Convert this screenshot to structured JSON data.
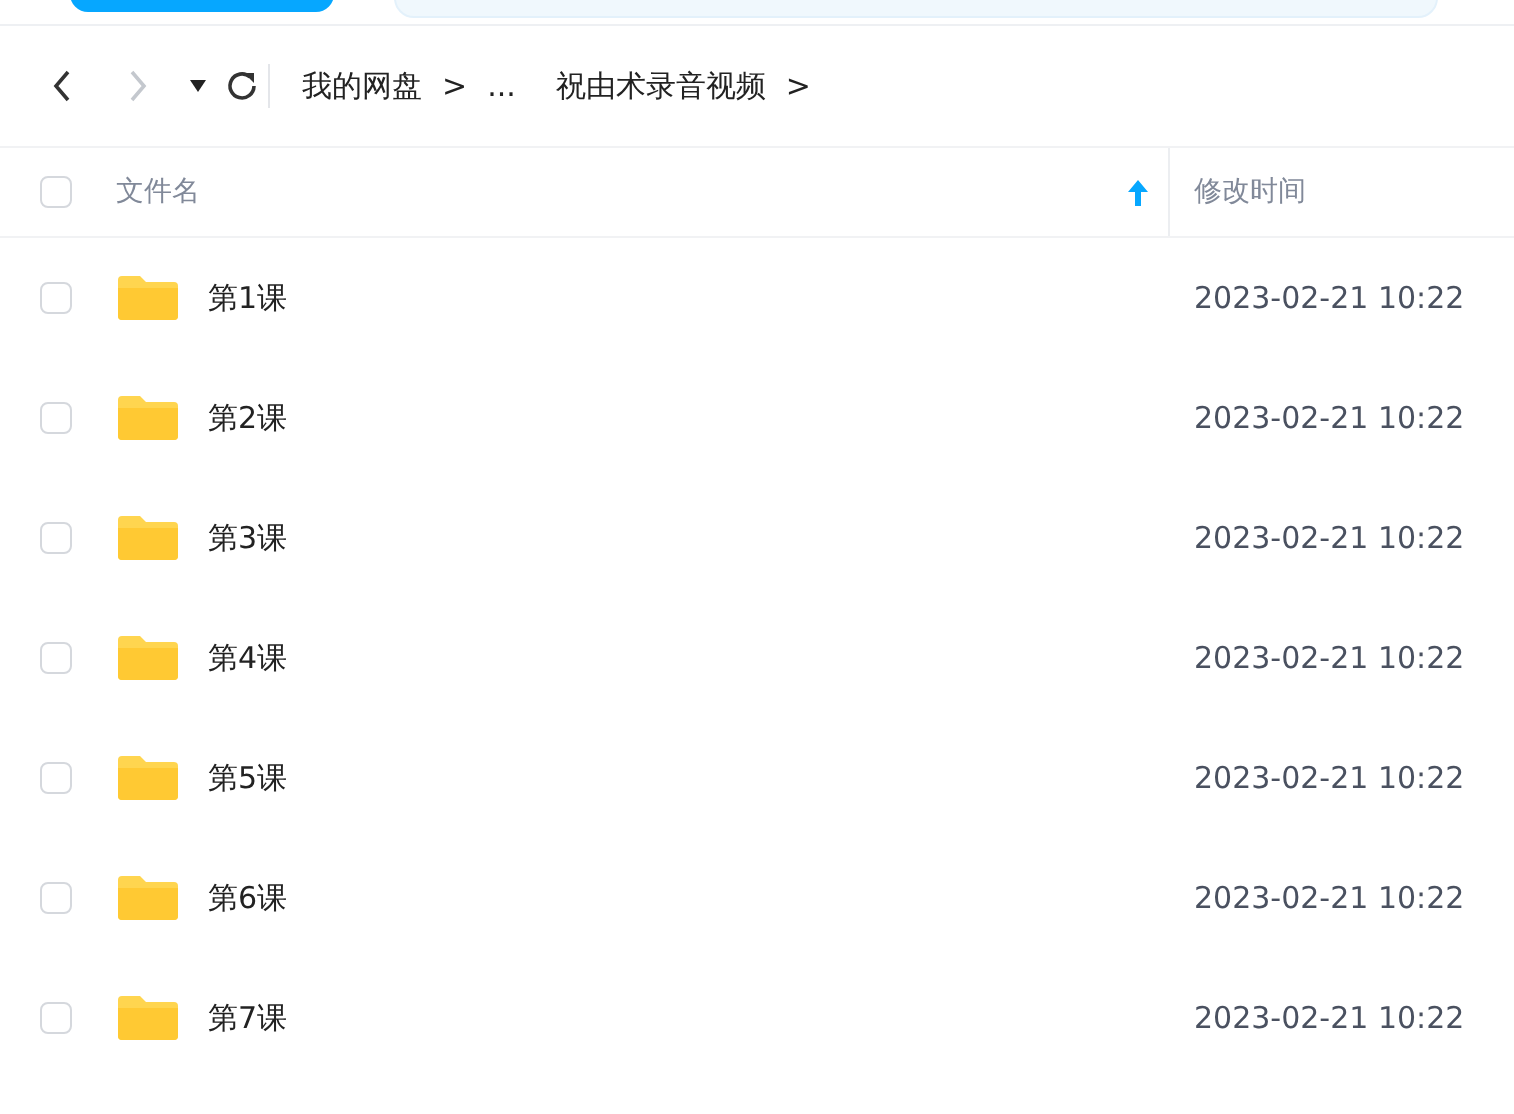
{
  "toolbar": {
    "back_disabled": false,
    "forward_disabled": true,
    "breadcrumb": [
      {
        "label": "我的网盘",
        "separator": ">"
      },
      {
        "label": "..."
      },
      {
        "label": "祝由术录音视频",
        "separator": ">"
      }
    ]
  },
  "table": {
    "columns": [
      {
        "label": "文件名",
        "sorted": true
      },
      {
        "label": "修改时间",
        "sorted": false
      }
    ],
    "header_checked": false,
    "rows": [
      {
        "name": "第1课",
        "modified": "2023-02-21 10:22",
        "checked": false
      },
      {
        "name": "第2课",
        "modified": "2023-02-21 10:22",
        "checked": false
      },
      {
        "name": "第3课",
        "modified": "2023-02-21 10:22",
        "checked": false
      },
      {
        "name": "第4课",
        "modified": "2023-02-21 10:22",
        "checked": false
      },
      {
        "name": "第5课",
        "modified": "2023-02-21 10:22",
        "checked": false
      },
      {
        "name": "第6课",
        "modified": "2023-02-21 10:22",
        "checked": false
      },
      {
        "name": "第7课",
        "modified": "2023-02-21 10:22",
        "checked": false
      }
    ]
  }
}
